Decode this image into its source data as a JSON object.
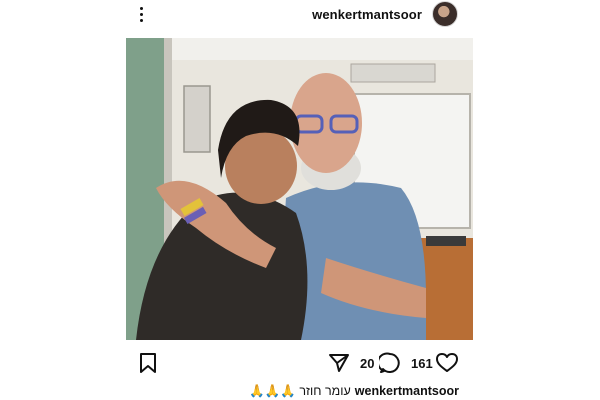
{
  "header": {
    "username": "wenkertmantsoor",
    "menu_icon": "more-vertical-icon",
    "avatar_icon": "profile-avatar"
  },
  "post": {
    "image_description_icon": "post-photo"
  },
  "actions": {
    "bookmark_icon": "bookmark-icon",
    "share_icon": "send-icon",
    "comment_icon": "comment-icon",
    "like_icon": "heart-icon",
    "comments_count": "20",
    "likes_count": "161"
  },
  "caption": {
    "username": "wenkertmantsoor",
    "text": "עומר חוזר 🙏🙏🙏"
  },
  "colors": {
    "text": "#111111",
    "background": "#ffffff"
  }
}
